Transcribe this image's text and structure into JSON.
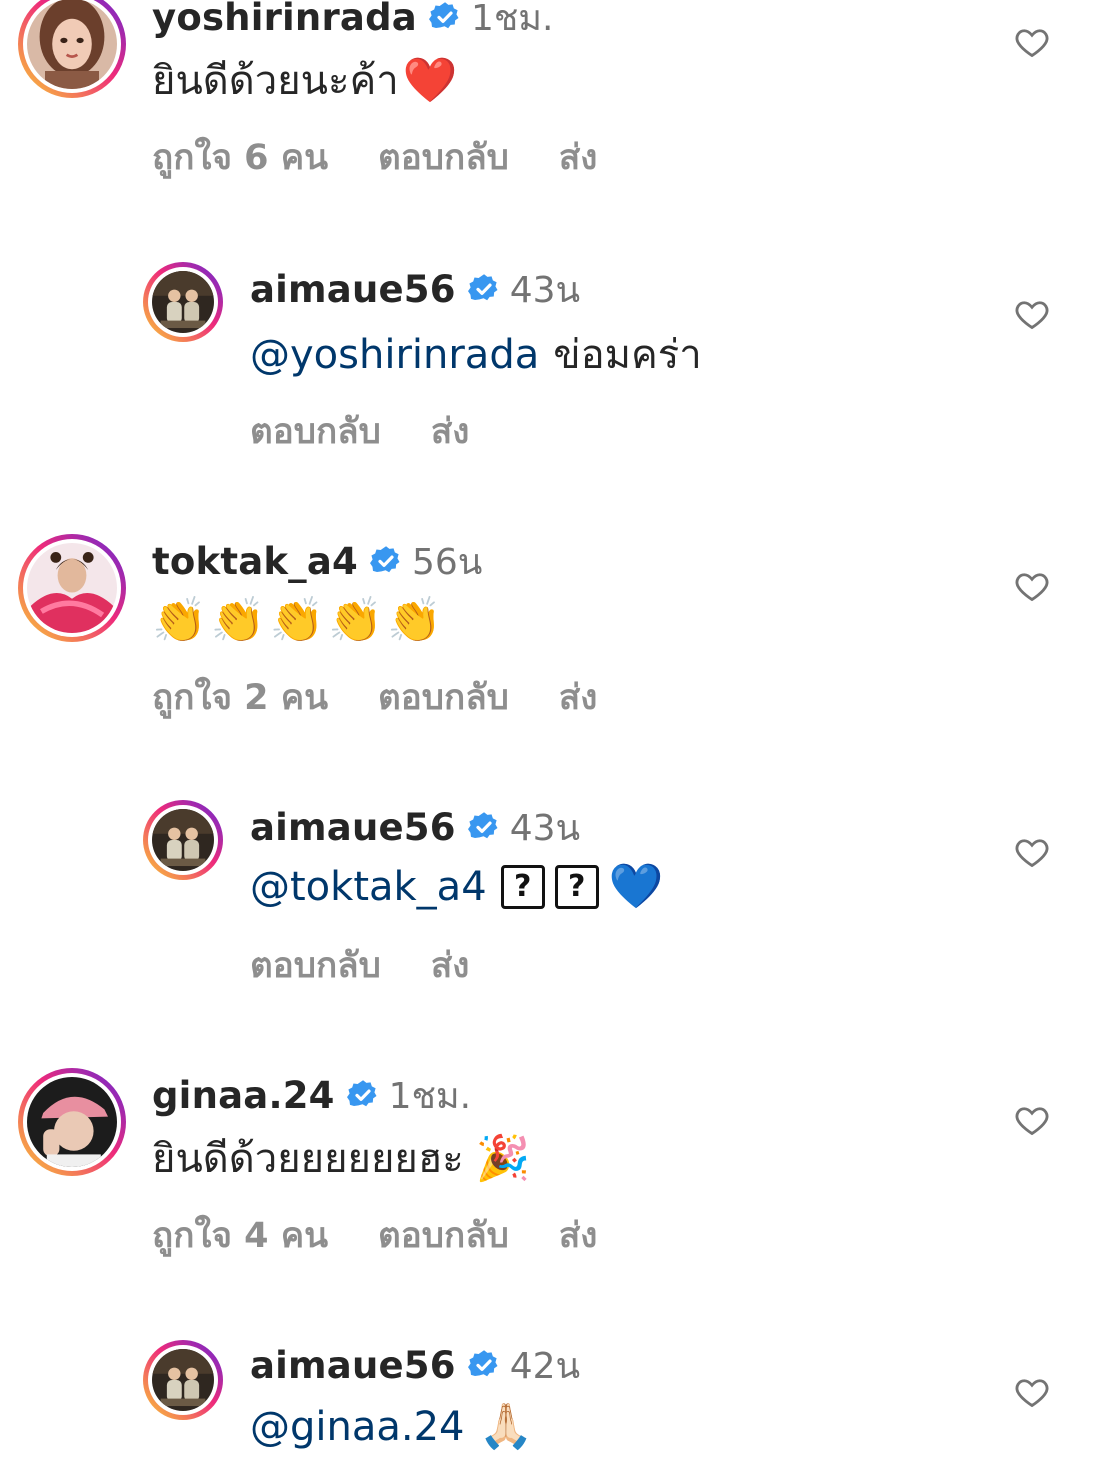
{
  "comments": [
    {
      "username": "yoshirinrada",
      "time": "1ชม.",
      "text": "ยินดีด้วยนะค้า",
      "emoji": "❤️",
      "likes": "ถูกใจ 6 คน",
      "reply": "ตอบกลับ",
      "send": "ส่ง",
      "avatar_icon": "woman-illustration-avatar"
    },
    {
      "username": "aimaue56",
      "time": "43น",
      "mention": "@yoshirinrada",
      "text": "ข่อมคร่า",
      "reply": "ตอบกลับ",
      "send": "ส่ง",
      "avatar_icon": "couple-photo-avatar"
    },
    {
      "username": "toktak_a4",
      "time": "56น",
      "emoji": "👏👏👏👏👏",
      "likes": "ถูกใจ 2 คน",
      "reply": "ตอบกลับ",
      "send": "ส่ง",
      "avatar_icon": "pink-outfit-avatar"
    },
    {
      "username": "aimaue56",
      "time": "43น",
      "mention": "@toktak_a4",
      "glyphs": [
        "?",
        "?"
      ],
      "emoji": "💙",
      "reply": "ตอบกลับ",
      "send": "ส่ง",
      "avatar_icon": "couple-photo-avatar"
    },
    {
      "username": "ginaa.24",
      "time": "1ชม.",
      "text": "ยินดีด้วยยยยยยฮะ",
      "emoji": "🎉",
      "likes": "ถูกใจ 4 คน",
      "reply": "ตอบกลับ",
      "send": "ส่ง",
      "avatar_icon": "pink-cap-avatar"
    },
    {
      "username": "aimaue56",
      "time": "42น",
      "mention": "@ginaa.24",
      "emoji": "🙏🏻",
      "avatar_icon": "couple-photo-avatar"
    }
  ],
  "colors": {
    "text": "#262626",
    "muted": "#8e8e8e",
    "mention": "#00376b",
    "verified": "#3897f0"
  }
}
